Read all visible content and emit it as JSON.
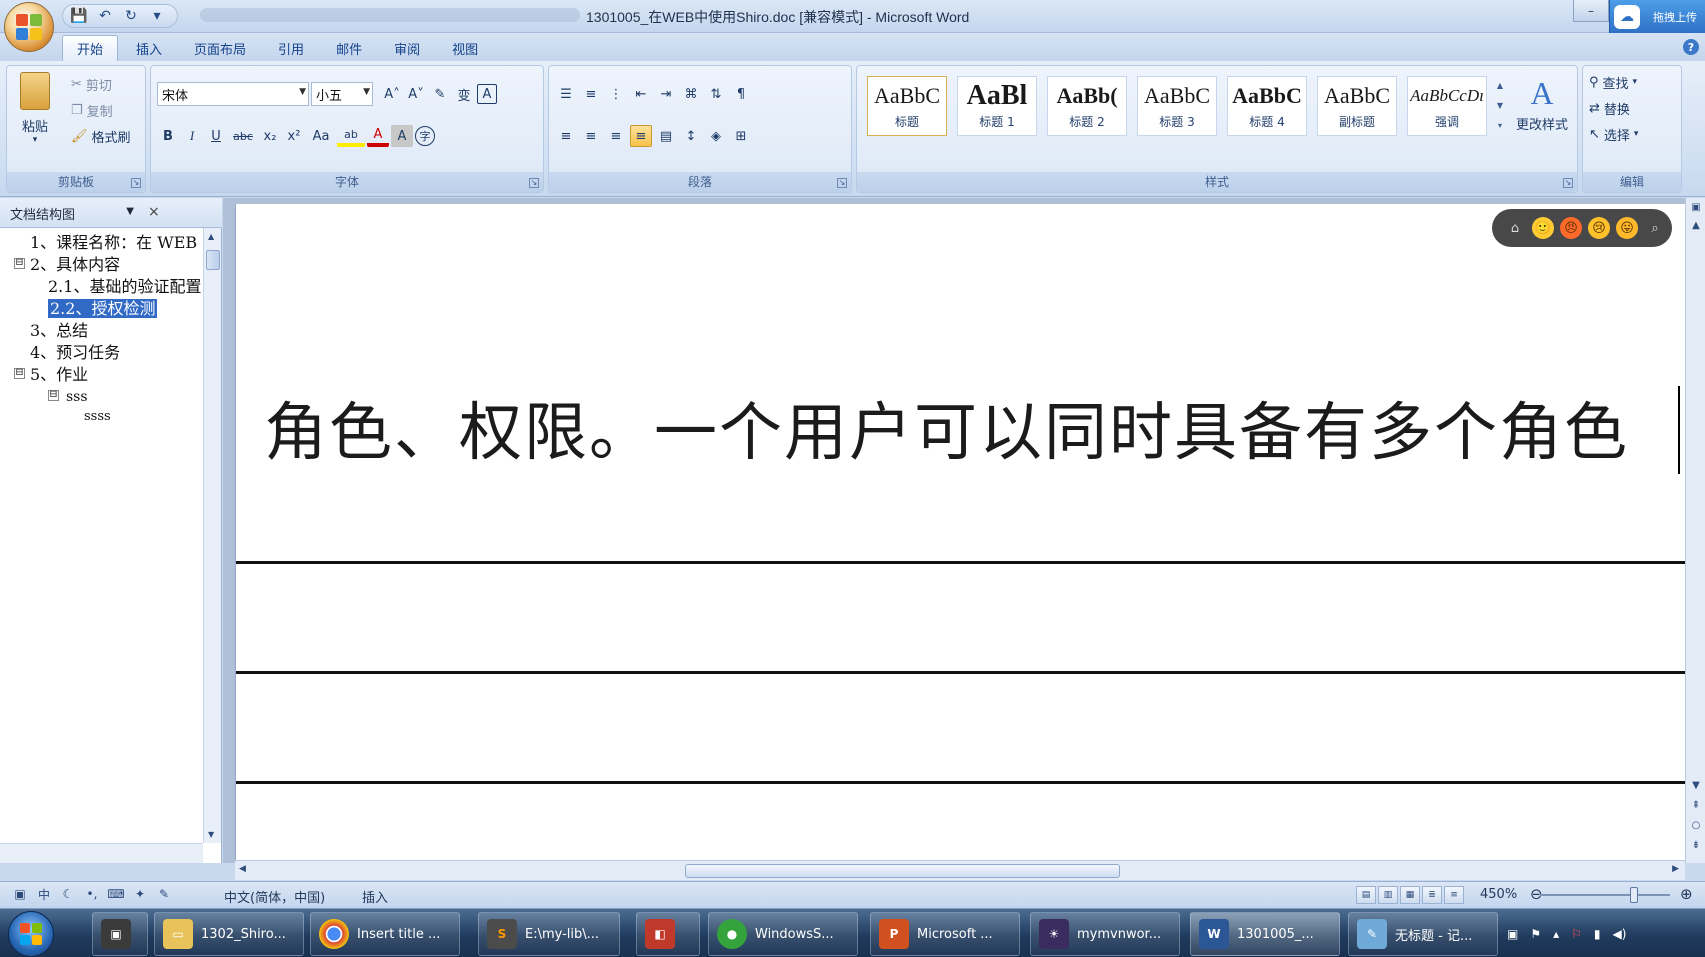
{
  "titlebar": {
    "title": "1301005_在WEB中使用Shiro.doc [兼容模式] - Microsoft Word",
    "cloud_upload": "拖拽上传",
    "qat": {
      "save": "💾",
      "undo": "↶",
      "redo": "↻",
      "more": "▾"
    }
  },
  "ribbon": {
    "tabs": [
      "开始",
      "插入",
      "页面布局",
      "引用",
      "邮件",
      "审阅",
      "视图"
    ],
    "clipboard": {
      "paste": "粘贴",
      "cut": "剪切",
      "copy": "复制",
      "format_painter": "格式刷",
      "label": "剪贴板"
    },
    "font": {
      "name": "宋体",
      "size": "小五",
      "label": "字体",
      "grow": "A˄",
      "shrink": "A˅",
      "clear": "✎",
      "phonetic": "变",
      "border_char": "A",
      "bold": "B",
      "italic": "I",
      "underline": "U",
      "strike": "abc",
      "sub": "x₂",
      "sup": "x²",
      "case": "Aa",
      "highlight": "ab",
      "color": "A",
      "shade": "A",
      "enclose": "字"
    },
    "paragraph": {
      "label": "段落"
    },
    "styles": {
      "label": "样式",
      "tiles": [
        {
          "sample": "AaBbC",
          "name": "标题"
        },
        {
          "sample": "AaBl",
          "name": "标题 1"
        },
        {
          "sample": "AaBb(",
          "name": "标题 2"
        },
        {
          "sample": "AaBbC",
          "name": "标题 3"
        },
        {
          "sample": "AaBbC",
          "name": "标题 4"
        },
        {
          "sample": "AaBbC",
          "name": "副标题"
        },
        {
          "sample": "AaBbCcDı",
          "name": "强调"
        }
      ],
      "change_styles": "更改样式"
    },
    "editing": {
      "find": "查找",
      "replace": "替换",
      "select": "选择",
      "label": "编辑"
    }
  },
  "navpane": {
    "title": "文档结构图",
    "close": "×",
    "items": [
      "1、课程名称：在 WEB",
      "2、具体内容",
      "2.1、基础的验证配置",
      "2.2、授权检测",
      "3、总结",
      "4、预习任务",
      "5、作业",
      "sss",
      "ssss"
    ],
    "toggles": [
      "⊟",
      "⊟",
      "⊟"
    ]
  },
  "document": {
    "text": "角色、权限。一个用户可以同时具备有多个角色"
  },
  "emoji_bar": [
    "⌂",
    "🙂",
    "😠",
    "😢",
    "😛",
    "⌕"
  ],
  "status": {
    "language": "中文(简体，中国)",
    "mode": "插入",
    "zoom": "450%",
    "zoom_level": 0.72
  },
  "taskbar": {
    "items": [
      {
        "label": "1302_Shiro..."
      },
      {
        "label": "Insert title ..."
      },
      {
        "label": "E:\\my-lib\\..."
      },
      {
        "label": "WindowsS..."
      },
      {
        "label": "Microsoft ..."
      },
      {
        "label": "mymvnwor..."
      },
      {
        "label": "1301005_..."
      },
      {
        "label": "无标题 - 记..."
      }
    ]
  }
}
